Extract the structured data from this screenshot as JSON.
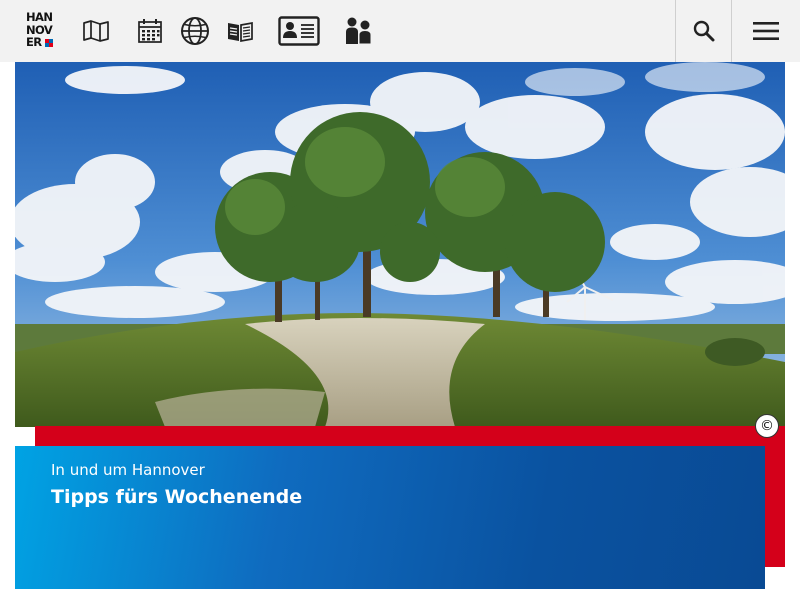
{
  "logo": {
    "line1": "HAN",
    "line2": "NOV",
    "line3": "ER"
  },
  "nav": [
    {
      "id": "map",
      "icon": "map-icon"
    },
    {
      "id": "calendar",
      "icon": "calendar-icon"
    },
    {
      "id": "globe",
      "icon": "globe-icon"
    },
    {
      "id": "book",
      "icon": "book-icon"
    },
    {
      "id": "contact",
      "icon": "id-card-icon"
    },
    {
      "id": "people",
      "icon": "people-icon"
    }
  ],
  "header": {
    "search_icon": "search-icon",
    "menu_icon": "hamburger-menu-icon"
  },
  "hero": {
    "copyright_symbol": "©"
  },
  "teaser": {
    "kicker": "In und um Hannover",
    "headline": "Tipps fürs Wochenende"
  },
  "colors": {
    "accent_red": "#d4001a",
    "accent_blue": "#0a52a0",
    "light_blue": "#00a3e4",
    "header_bg": "#f2f2f2"
  }
}
